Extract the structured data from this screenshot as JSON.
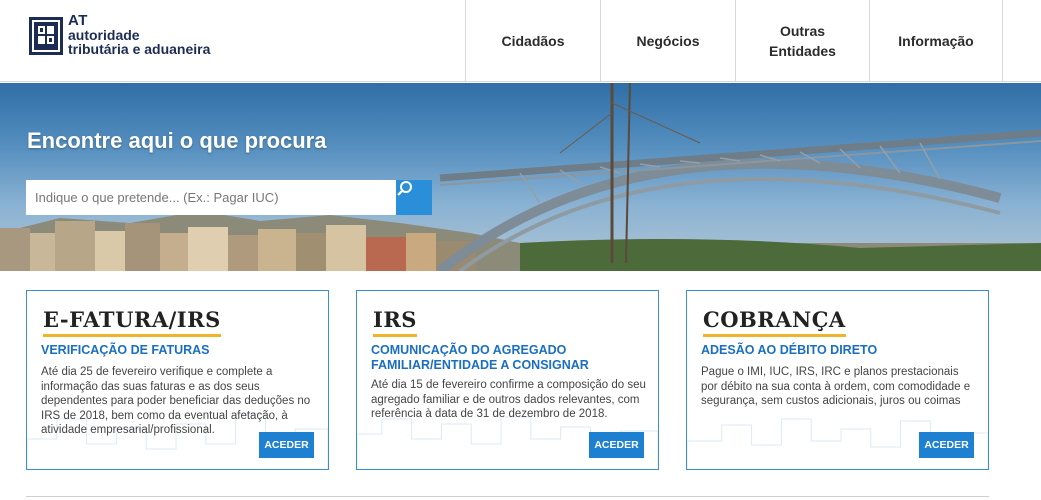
{
  "header": {
    "logo": {
      "line1": "AT",
      "line2": "autoridade",
      "line3": "tributária e aduaneira"
    },
    "nav": [
      {
        "label": "Cidadãos"
      },
      {
        "label": "Negócios"
      },
      {
        "label": "Outras Entidades",
        "line1": "Outras",
        "line2": "Entidades"
      },
      {
        "label": "Informação"
      }
    ]
  },
  "hero": {
    "title": "Encontre aqui o que procura",
    "search": {
      "placeholder": "Indique o que pretende... (Ex.: Pagar IUC)",
      "value": ""
    }
  },
  "cards": [
    {
      "title": "E-FATURA/IRS",
      "subtitle": "VERIFICAÇÃO DE FATURAS",
      "text": "Até dia 25 de fevereiro verifique e complete a informação das suas faturas e as dos seus dependentes para poder beneficiar das deduções no IRS de 2018, bem como da eventual afetação, à atividade empresarial/profissional.",
      "button": "ACEDER"
    },
    {
      "title": "IRS",
      "subtitle": "COMUNICAÇÃO DO AGREGADO FAMILIAR/ENTIDADE A CONSIGNAR",
      "text": "Até dia 15 de fevereiro confirme a composição do seu agregado familiar e de outros dados relevantes, com referência à data de 31 de dezembro de 2018.",
      "button": "ACEDER"
    },
    {
      "title": "COBRANÇA",
      "subtitle": "ADESÃO AO DÉBITO DIRETO",
      "text": "Pague o IMI, IUC, IRS, IRC e planos prestacionais por débito na sua conta à ordem, com comodidade e segurança, sem custos adicionais, juros ou coimas",
      "button": "ACEDER"
    }
  ],
  "colors": {
    "brand": "#1c2c55",
    "accent": "#1e80d0",
    "underline": "#f0b32a"
  },
  "icons": {
    "search": "search-icon",
    "logo": "at-shield-logo"
  }
}
